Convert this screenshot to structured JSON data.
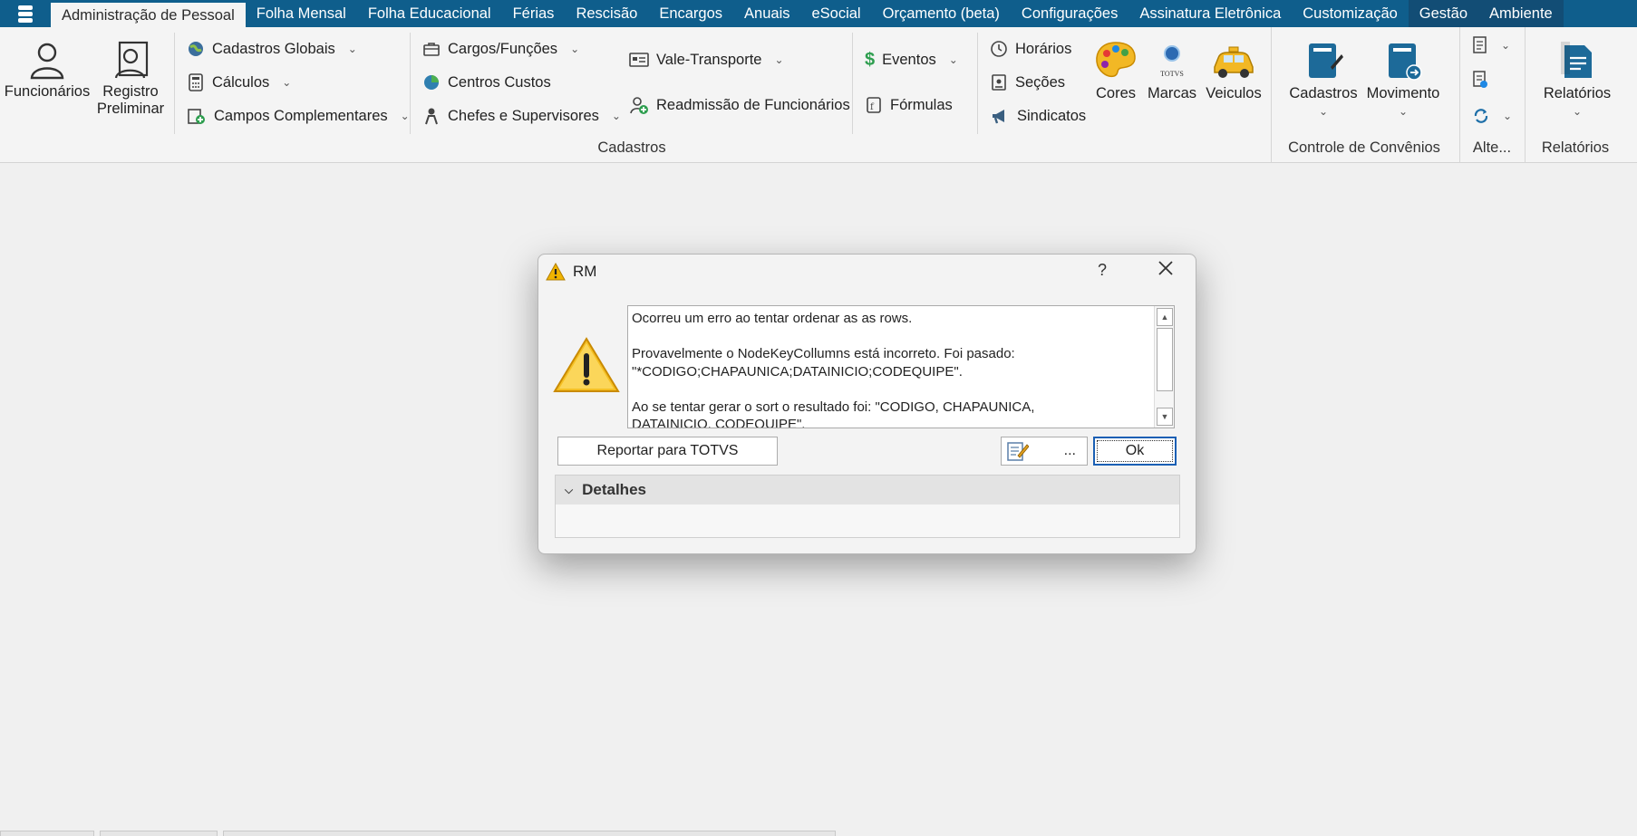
{
  "menu": {
    "tabs": [
      "Administração de Pessoal",
      "Folha Mensal",
      "Folha Educacional",
      "Férias",
      "Rescisão",
      "Encargos",
      "Anuais",
      "eSocial",
      "Orçamento (beta)",
      "Configurações",
      "Assinatura Eletrônica",
      "Customização",
      "Gestão",
      "Ambiente"
    ]
  },
  "ribbon": {
    "funcionarios": "Funcionários",
    "registro_line1": "Registro",
    "registro_line2": "Preliminar",
    "cadastros_globais": "Cadastros Globais",
    "calculos": "Cálculos",
    "campos_complementares": "Campos Complementares",
    "cargos_funcoes": "Cargos/Funções",
    "centros_custos": "Centros Custos",
    "chefes_supervisores": "Chefes e Supervisores",
    "vale_transporte": "Vale-Transporte",
    "readmissao": "Readmissão de Funcionários",
    "eventos": "Eventos",
    "formulas": "Fórmulas",
    "horarios": "Horários",
    "secoes": "Seções",
    "sindicatos": "Sindicatos",
    "cores": "Cores",
    "marcas": "Marcas",
    "veiculos": "Veiculos",
    "cadastros": "Cadastros",
    "movimento": "Movimento",
    "relatorios": "Relatórios",
    "group_cadastros": "Cadastros",
    "group_convenios": "Controle de Convênios",
    "group_alte": "Alte...",
    "group_relatorios": "Relatórios",
    "marcas_logo": "TOTVS"
  },
  "dialog": {
    "title": "RM",
    "help": "?",
    "message_line1": "Ocorreu um erro ao tentar ordenar as as rows.",
    "message_line2a": "Provavelmente o NodeKeyCollumns está incorreto. Foi pasado:",
    "message_line2b": "\"*CODIGO;CHAPAUNICA;DATAINICIO;CODEQUIPE\".",
    "message_line3a": "Ao se tentar gerar o sort o resultado foi: \"CODIGO, CHAPAUNICA,",
    "message_line3b": "DATAINICIO, CODEQUIPE\".",
    "report_button": "Reportar para TOTVS",
    "more_button": "...",
    "ok_button": "Ok",
    "details_label": "Detalhes"
  },
  "colors": {
    "menu_bar": "#0f5e8c",
    "accent": "#1a5fb4",
    "warning": "#f0b400"
  }
}
